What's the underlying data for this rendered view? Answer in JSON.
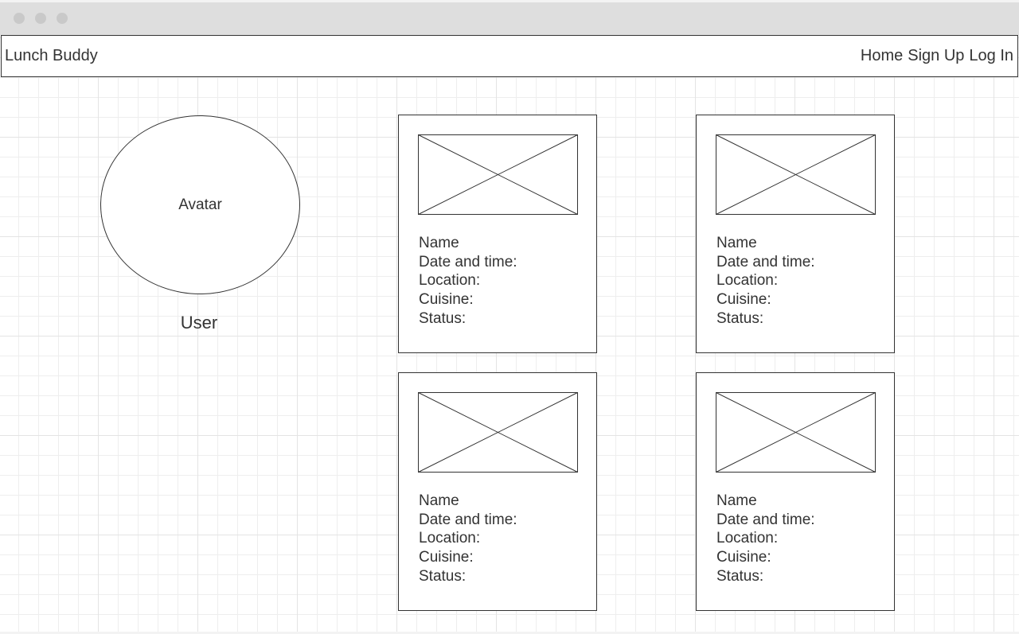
{
  "navbar": {
    "brand": "Lunch Buddy",
    "links": [
      {
        "label": "Home"
      },
      {
        "label": "Sign Up"
      },
      {
        "label": "Log In"
      }
    ]
  },
  "profile": {
    "avatar_label": "Avatar",
    "user_label": "User"
  },
  "cards": [
    {
      "name": "Name",
      "date_time": "Date and time:",
      "location": "Location:",
      "cuisine": "Cuisine:",
      "status": "Status:"
    },
    {
      "name": "Name",
      "date_time": "Date and time:",
      "location": "Location:",
      "cuisine": "Cuisine:",
      "status": "Status:"
    },
    {
      "name": "Name",
      "date_time": "Date and time:",
      "location": "Location:",
      "cuisine": "Cuisine:",
      "status": "Status:"
    },
    {
      "name": "Name",
      "date_time": "Date and time:",
      "location": "Location:",
      "cuisine": "Cuisine:",
      "status": "Status:"
    }
  ],
  "colors": {
    "stroke": "#333333",
    "grid": "#e4e4e4",
    "titlebar": "#dedede"
  }
}
